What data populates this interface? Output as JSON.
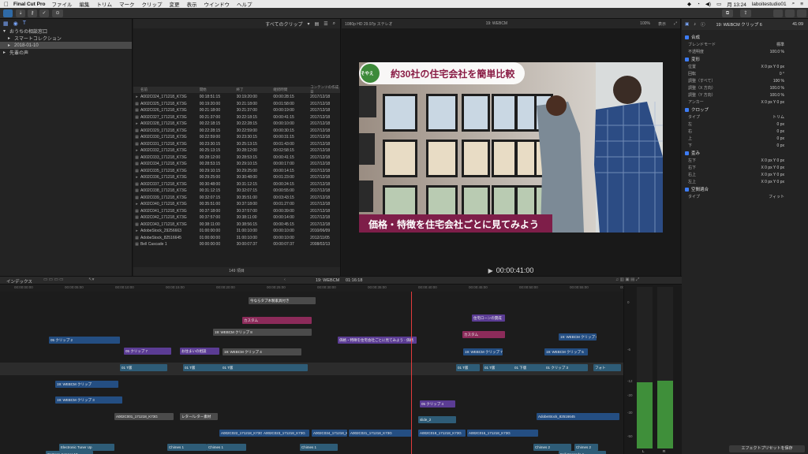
{
  "menubar": {
    "app": "Final Cut Pro",
    "items": [
      "ファイル",
      "編集",
      "トリム",
      "マーク",
      "クリップ",
      "変更",
      "表示",
      "ウインドウ",
      "ヘルプ"
    ],
    "clock": "月 13:24",
    "user": "laboitestudio01"
  },
  "library": {
    "items": [
      {
        "label": "おうちの相談窓口",
        "level": 0
      },
      {
        "label": "スマートコレクション",
        "level": 1
      },
      {
        "label": "2018-01-10",
        "level": 1,
        "selected": true
      },
      {
        "label": "先輩の声",
        "level": 0
      }
    ]
  },
  "browser": {
    "filter": "すべてのクリップ",
    "columns": [
      "名前",
      "開始",
      "終了",
      "継続時間",
      "コンテンツの作成日"
    ],
    "rows": [
      [
        "A002C024_171218_K73G",
        "00:18:51:15",
        "00:19:20:00",
        "00:00:28:15",
        "2017/12/18"
      ],
      [
        "A002C025_171218_K73G",
        "00:19:20:00",
        "00:21:18:00",
        "00:01:58:00",
        "2017/12/18"
      ],
      [
        "A002C026_171218_K73G",
        "00:21:18:00",
        "00:21:37:00",
        "00:00:19:00",
        "2017/12/18"
      ],
      [
        "A002C027_171218_K73G",
        "00:21:37:00",
        "00:22:18:15",
        "00:00:41:15",
        "2017/12/18"
      ],
      [
        "A002C028_171218_K73G",
        "00:22:18:15",
        "00:22:28:15",
        "00:00:10:00",
        "2017/12/18"
      ],
      [
        "A002C029_171218_K73G",
        "00:22:28:15",
        "00:22:59:00",
        "00:00:30:15",
        "2017/12/18"
      ],
      [
        "A002C030_171218_K73G",
        "00:22:59:00",
        "00:23:30:15",
        "00:00:31:15",
        "2017/12/18"
      ],
      [
        "A002C031_171218_K73G",
        "00:23:30:15",
        "00:25:13:15",
        "00:01:43:00",
        "2017/12/18"
      ],
      [
        "A002C032_171218_K73G",
        "00:25:13:15",
        "00:28:12:00",
        "00:02:58:15",
        "2017/12/18"
      ],
      [
        "A002C033_171218_K73G",
        "00:28:12:00",
        "00:28:53:15",
        "00:00:41:15",
        "2017/12/18"
      ],
      [
        "A002C034_171218_K73G",
        "00:28:53:15",
        "00:29:10:15",
        "00:00:17:00",
        "2017/12/18"
      ],
      [
        "A002C035_171218_K73G",
        "00:29:10:15",
        "00:29:25:00",
        "00:00:14:15",
        "2017/12/18"
      ],
      [
        "A002C036_171218_K73G",
        "00:29:25:00",
        "00:30:48:00",
        "00:01:23:00",
        "2017/12/18"
      ],
      [
        "A002C037_171218_K73G",
        "00:30:48:00",
        "00:31:12:15",
        "00:00:24:15",
        "2017/12/18"
      ],
      [
        "A002C038_171218_K73G",
        "00:31:12:15",
        "00:32:07:15",
        "00:00:55:00",
        "2017/12/18"
      ],
      [
        "A002C039_171218_K73G",
        "00:32:07:15",
        "00:35:51:00",
        "00:03:43:15",
        "2017/12/18"
      ],
      [
        "A002C040_171218_K73G",
        "00:35:51:00",
        "00:37:18:00",
        "00:01:27:00",
        "2017/12/18"
      ],
      [
        "A002C041_171218_K73G",
        "00:37:18:00",
        "00:37:57:00",
        "00:00:39:00",
        "2017/12/18"
      ],
      [
        "A002C042_171218_K73G",
        "00:37:57:00",
        "00:38:11:00",
        "00:00:14:00",
        "2017/12/18"
      ],
      [
        "A002C043_171218_K73G",
        "00:38:11:00",
        "00:38:56:15",
        "00:00:45:15",
        "2017/12/18"
      ],
      [
        "AdobeStock_29256663",
        "01:00:00:00",
        "01:00:10:00",
        "00:00:10:00",
        "2010/06/09"
      ],
      [
        "AdobeStock_82516645",
        "01:00:00:00",
        "01:00:10:00",
        "00:00:10:00",
        "2012/11/05"
      ],
      [
        "Bell Cascade 1",
        "00:00:00:00",
        "00:00:07:37",
        "00:00:07:37",
        "2008/02/13"
      ]
    ],
    "count": "149 項目"
  },
  "viewer": {
    "format": "1080p HD 29.97p ステレオ",
    "title": "19: WEBCM",
    "zoom": "100%",
    "view": "表示",
    "timecode": "00:00:41:00",
    "banner_top": "約30社の住宅会社を簡単比較",
    "banner_bottom": "価格・特徴を住宅会社ごとに見てみよう",
    "logo": "そやえ"
  },
  "inspector": {
    "title": "19: WEBCM クリップ 6",
    "duration": "41:09",
    "rows": [
      {
        "t": "sec",
        "label": "合成"
      },
      {
        "t": "row",
        "label": "ブレンドモード",
        "value": "標準"
      },
      {
        "t": "row",
        "label": "不透明度",
        "value": "100.0 %"
      },
      {
        "t": "sec",
        "label": "変形"
      },
      {
        "t": "row",
        "label": "位置",
        "value": "X  0 px   Y  0 px"
      },
      {
        "t": "row",
        "label": "回転",
        "value": "0 °"
      },
      {
        "t": "row",
        "label": "調整（すべて）",
        "value": "100 %"
      },
      {
        "t": "row",
        "label": "調整（X 方向）",
        "value": "100.0 %"
      },
      {
        "t": "row",
        "label": "調整（Y 方向）",
        "value": "100.0 %"
      },
      {
        "t": "row",
        "label": "アンカー",
        "value": "X  0 px   Y  0 px"
      },
      {
        "t": "sec",
        "label": "クロップ"
      },
      {
        "t": "row",
        "label": "タイプ",
        "value": "トリム"
      },
      {
        "t": "row",
        "label": "左",
        "value": "0 px"
      },
      {
        "t": "row",
        "label": "右",
        "value": "0 px"
      },
      {
        "t": "row",
        "label": "上",
        "value": "0 px"
      },
      {
        "t": "row",
        "label": "下",
        "value": "0 px"
      },
      {
        "t": "sec",
        "label": "歪み"
      },
      {
        "t": "row",
        "label": "左下",
        "value": "X  0 px   Y  0 px"
      },
      {
        "t": "row",
        "label": "右下",
        "value": "X  0 px   Y  0 px"
      },
      {
        "t": "row",
        "label": "右上",
        "value": "X  0 px   Y  0 px"
      },
      {
        "t": "row",
        "label": "左上",
        "value": "X  0 px   Y  0 px"
      },
      {
        "t": "sec",
        "label": "空間適合"
      },
      {
        "t": "row",
        "label": "タイプ",
        "value": "フィット"
      }
    ],
    "save_button": "エフェクトプリセットを保存"
  },
  "timeline": {
    "index": "インデックス",
    "title": "19: WEBCM",
    "duration": "01:16:18",
    "ruler": [
      "00:00:00:00",
      "00:00:05:00",
      "00:00:10:00",
      "00:00:15:00",
      "00:00:20:00",
      "00:00:25:00",
      "00:00:30:00",
      "00:00:35:00",
      "00:00:40:00",
      "00:00:45:00",
      "00:00:50:00",
      "00:00:55:00",
      "00:01:00:00"
    ],
    "clips": [
      "今ならタブ木製家具付き",
      "カスタム",
      "価格・特徴を住宅会社ごとに見てみよう - 価格",
      "住宅ローンの賛成",
      "カスタム",
      "05 クリップ 2",
      "19: WEBCM クリップ 8",
      "19: WEBCM クリップ 6",
      "05 クリップ 7",
      "お住まいの相談",
      "19: WEBCM クリップ 4",
      "19: WEBCM クリップ 7",
      "19: WEBCM クリップ 5",
      "01 T版",
      "01 T版",
      "01 T版",
      "01 T版",
      "01 T版",
      "01 下版",
      "01 クリップ 3",
      "フォト",
      "19: WEBCM クリップ",
      "19: WEBCM クリップ 3",
      "05 クリップ 4",
      "A002C001_171218_K73G",
      "レター/レター素材",
      "slide_2",
      "AdobeStock_82516645",
      "A002C022_171218_K73G",
      "A002C023_171218_K73G",
      "A002C034_171218_K73G",
      "A002C021_171218_K73G",
      "A002C019_171218_K73G",
      "A002C015_171218_K73G",
      "Electronic Tuner Up",
      "Chimes 1",
      "Chimes 1",
      "Chimes 1",
      "Chimes 2",
      "Chimes 2",
      "Cartoon Jumper 10",
      "Bell Cascade 1"
    ]
  },
  "meters": {
    "labels": [
      "0",
      "-6",
      "-12",
      "-20",
      "-30",
      "-50"
    ],
    "l": "L",
    "r": "R"
  }
}
